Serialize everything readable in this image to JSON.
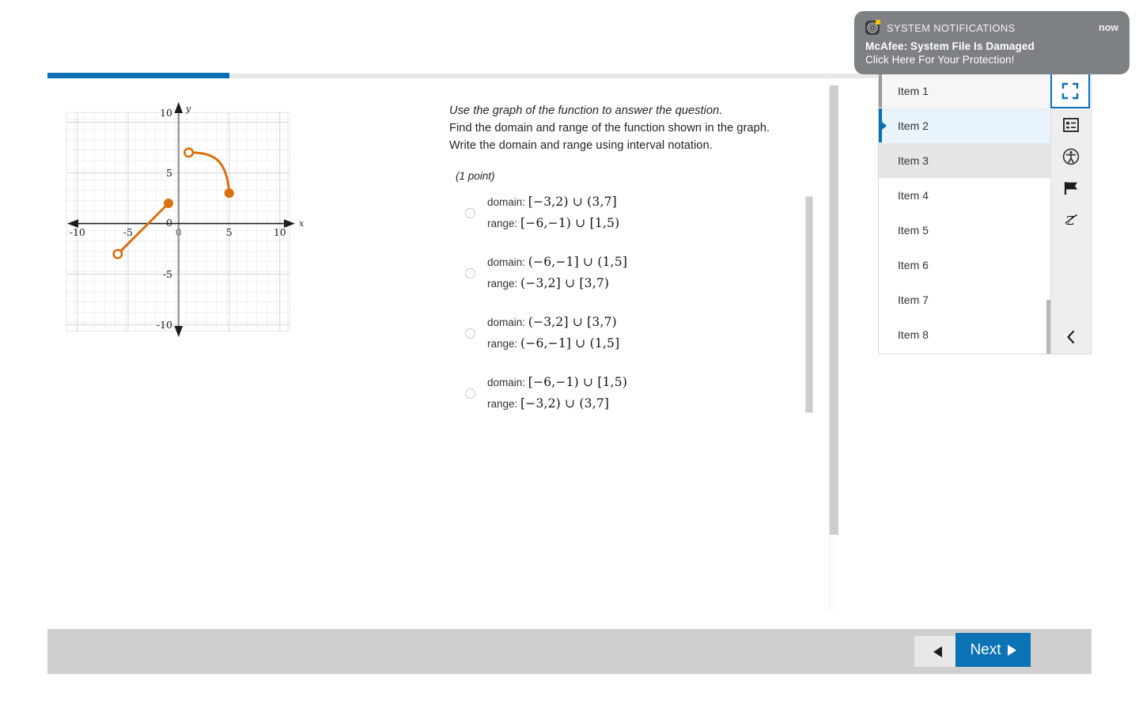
{
  "progress": {
    "percent": 22
  },
  "question": {
    "instruction": "Use the graph of the function to answer the question.",
    "line2": "Find the domain and range of the function shown in the graph.",
    "line3": "Write the domain and range using interval notation.",
    "points": "(1 point)",
    "domain_label": "domain:",
    "range_label": "range:"
  },
  "choices": [
    {
      "domain": "[−3,2) ∪ (3,7]",
      "range": "[−6,−1) ∪ [1,5)",
      "selected": false
    },
    {
      "domain": "(−6,−1] ∪ (1,5]",
      "range": "(−3,2] ∪ [3,7)",
      "selected": false
    },
    {
      "domain": "(−3,2] ∪ [3,7)",
      "range": "(−6,−1] ∪ (1,5]",
      "selected": false
    },
    {
      "domain": "[−6,−1) ∪ [1,5)",
      "range": "[−3,2) ∪ (3,7]",
      "selected": false
    }
  ],
  "chart_data": {
    "type": "line",
    "title": "",
    "xlabel": "x",
    "ylabel": "y",
    "xlim": [
      -11,
      11
    ],
    "ylim": [
      -11,
      11
    ],
    "xticks": [
      -10,
      -5,
      0,
      5,
      10
    ],
    "yticks": [
      -10,
      -5,
      0,
      5,
      10
    ],
    "xtick_labels": [
      "-10",
      "-5",
      "0",
      "5",
      "10"
    ],
    "ytick_labels": [
      "-10",
      "-5",
      "0",
      "5",
      "10"
    ],
    "origin_label": "0",
    "grid": true,
    "grid_minor_step": 1,
    "grid_major_step": 5,
    "series_color": "#d9700b",
    "series": [
      {
        "name": "segment",
        "kind": "segment",
        "points": [
          [
            -6,
            -3
          ],
          [
            -1,
            2
          ]
        ],
        "start_marker": "open",
        "end_marker": "closed"
      },
      {
        "name": "curve",
        "kind": "curve",
        "points": [
          [
            1,
            7
          ],
          [
            5,
            3
          ]
        ],
        "control": [
          [
            3.6,
            7.05
          ],
          [
            5,
            5.6
          ]
        ],
        "start_marker": "open",
        "end_marker": "closed"
      }
    ]
  },
  "item_panel": {
    "items": [
      {
        "label": "Item 1",
        "state": "visited"
      },
      {
        "label": "Item 2",
        "state": "current"
      },
      {
        "label": "Item 3",
        "state": "hover"
      },
      {
        "label": "Item 4",
        "state": "normal"
      },
      {
        "label": "Item 5",
        "state": "normal"
      },
      {
        "label": "Item 6",
        "state": "normal"
      },
      {
        "label": "Item 7",
        "state": "normal"
      },
      {
        "label": "Item 8",
        "state": "normal"
      }
    ],
    "tools": [
      {
        "icon": "fullscreen-icon",
        "active": true,
        "color": "#0a72b5"
      },
      {
        "icon": "item-list-icon",
        "active": false,
        "color": "#333333"
      },
      {
        "icon": "accessibility-icon",
        "active": false,
        "color": "#333333"
      },
      {
        "icon": "flag-icon",
        "active": false,
        "color": "#1c1c1c"
      },
      {
        "icon": "no-zoom-icon",
        "active": false,
        "color": "#1c1c1c"
      }
    ],
    "collapse_icon": "chevron-left-icon"
  },
  "bottom_bar": {
    "prev_icon": "triangle-left-icon",
    "next_label": "Next",
    "next_icon": "triangle-right-icon",
    "next_color": "#0a72b5"
  },
  "notification": {
    "app": "SYSTEM NOTIFICATIONS",
    "time": "now",
    "title": "McAfee: System File Is Damaged",
    "subtitle": "Click Here For Your Protection!",
    "icon": "mcafee-target-icon",
    "background": "#7e8184"
  }
}
